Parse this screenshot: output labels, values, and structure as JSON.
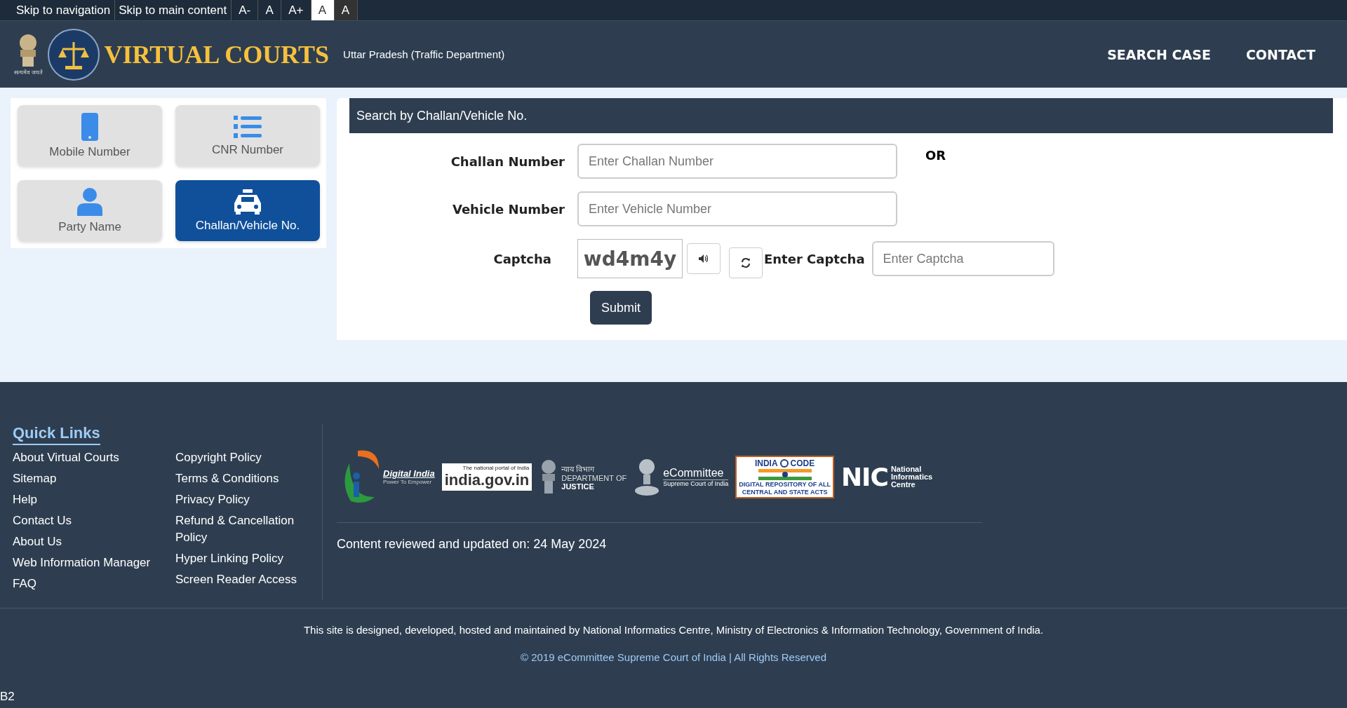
{
  "top_bar": {
    "links": [
      "Skip to navigation",
      "Skip to main content"
    ],
    "text_buttons": [
      {
        "label": "A-",
        "kind": "size"
      },
      {
        "label": "A",
        "kind": "size"
      },
      {
        "label": "A+",
        "kind": "size"
      },
      {
        "label": "A",
        "kind": "contrast-light"
      },
      {
        "label": "A",
        "kind": "contrast-dark"
      }
    ]
  },
  "header": {
    "emblem_caption": "सत्यमेव जयते",
    "title": "VIRTUAL COURTS",
    "subtitle": "Uttar Pradesh (Traffic Department)",
    "nav": [
      "SEARCH CASE",
      "CONTACT"
    ]
  },
  "search_options": [
    {
      "label": "Mobile Number",
      "kind": "phone",
      "selected": false
    },
    {
      "label": "CNR Number",
      "kind": "list",
      "selected": false
    },
    {
      "label": "Party Name",
      "kind": "person",
      "selected": false
    },
    {
      "label": "Challan/Vehicle No.",
      "kind": "taxi",
      "selected": true
    }
  ],
  "form": {
    "title": "Search by Challan/Vehicle No.",
    "fields": [
      {
        "label": "Challan Number",
        "placeholder": "Enter Challan Number"
      },
      {
        "label": "Vehicle Number",
        "placeholder": "Enter Vehicle Number"
      }
    ],
    "or_text": "OR",
    "captcha": {
      "label": "Captcha",
      "image_text": "wd4m4y",
      "entry_label": "Enter Captcha",
      "placeholder": "Enter Captcha"
    },
    "submit": "Submit"
  },
  "footer": {
    "quick_links_title": "Quick Links",
    "links_column_1": [
      "About Virtual Courts",
      "Sitemap",
      "Help",
      "Contact Us",
      "About Us",
      "Web Information Manager",
      "FAQ"
    ],
    "links_column_2": [
      "Copyright Policy",
      "Terms & Conditions",
      "Privacy Policy",
      "Refund & Cancellation Policy",
      "Hyper Linking Policy",
      "Screen Reader Access"
    ],
    "logos": [
      {
        "kind": "digital-india",
        "lines": [
          "Digital India",
          "Power To Empower"
        ]
      },
      {
        "kind": "india-gov",
        "lines": [
          "The national portal of India",
          "india.gov.in"
        ]
      },
      {
        "kind": "justice",
        "lines": [
          "न्याय विभाग",
          "DEPARTMENT OF",
          "JUSTICE"
        ]
      },
      {
        "kind": "ecommittee",
        "lines": [
          "eCommittee",
          "Supreme Court of India"
        ]
      },
      {
        "kind": "india-code",
        "lines": [
          "INDIA",
          "CODE",
          "DIGITAL REPOSITORY OF ALL",
          "CENTRAL AND STATE ACTS"
        ]
      },
      {
        "kind": "nic",
        "lines": [
          "NIC",
          "National",
          "Informatics",
          "Centre"
        ]
      }
    ],
    "updated": "Content reviewed and updated on: 24 May 2024",
    "credit": "This site is designed, developed, hosted and maintained by National Informatics Centre, Ministry of Electronics & Information Technology, Government of India.",
    "copyright": "© 2019 eCommittee Supreme Court of India | All Rights Reserved"
  },
  "build_label": "B2"
}
